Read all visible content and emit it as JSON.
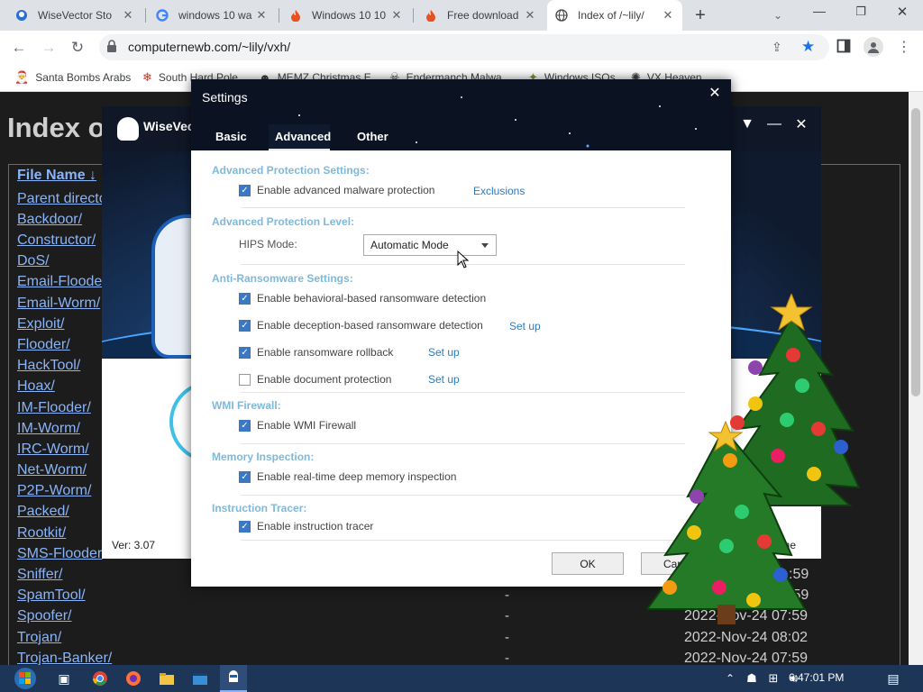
{
  "browser": {
    "tabs": [
      {
        "label": "WiseVector Sto",
        "icon": "wisevector-icon"
      },
      {
        "label": "windows 10 wa",
        "icon": "google-icon"
      },
      {
        "label": "Windows 10 10",
        "icon": "flame-icon"
      },
      {
        "label": "Free download",
        "icon": "flame-icon"
      },
      {
        "label": "Index of /~lily/",
        "icon": "globe-icon"
      }
    ],
    "new_tab": "+",
    "url": "computernewb.com/~lily/vxh/",
    "bookmarks": [
      {
        "label": "Santa Bombs Arabs",
        "icon": "santa-icon"
      },
      {
        "label": "South Hard Pole",
        "icon": "snowflake-icon"
      },
      {
        "label": "MEMZ Christmas E",
        "icon": "memz-icon"
      },
      {
        "label": "Endermanch Malwa",
        "icon": "skull-icon"
      },
      {
        "label": "Windows ISOs",
        "icon": "windows-icon"
      },
      {
        "label": "VX Heaven",
        "icon": "vx-icon"
      }
    ]
  },
  "listing": {
    "title": "Index o",
    "column_header": "File Name  ↓",
    "entries": [
      "Parent directo",
      "Backdoor/",
      "Constructor/",
      "DoS/",
      "Email-Floode",
      "Email-Worm/",
      "Exploit/",
      "Flooder/",
      "HackTool/",
      "Hoax/",
      "IM-Flooder/",
      "IM-Worm/",
      "IRC-Worm/",
      "Net-Worm/",
      "P2P-Worm/",
      "Packed/",
      "Rootkit/",
      "SMS-Flooder",
      "Sniffer/",
      "SpamTool/",
      "Spoofer/",
      "Trojan/",
      "Trojan-Banker/"
    ],
    "rows_right": [
      {
        "size": "-",
        "date": ":59"
      },
      {
        "size": "-",
        "date": ":59"
      },
      {
        "size": "-",
        "date": "2022-Nov-24 07:59"
      },
      {
        "size": "-",
        "date": "2022-Nov-24 08:02"
      },
      {
        "size": "-",
        "date": "2022-Nov-24 07:59"
      }
    ]
  },
  "wisevector": {
    "title": "WiseVec",
    "version": "Ver: 3.07",
    "quarantine": "ntine"
  },
  "settings": {
    "title": "Settings",
    "tabs": [
      "Basic",
      "Advanced",
      "Other"
    ],
    "active_tab": "Advanced",
    "sections": {
      "adv_protection_settings": "Advanced Protection Settings:",
      "adv_protection_level": "Advanced Protection Level:",
      "anti_ransomware": "Anti-Ransomware Settings:",
      "wmi_firewall": "WMI Firewall:",
      "memory_inspection": "Memory Inspection:",
      "instruction_tracer": "Instruction Tracer:"
    },
    "options": {
      "malware_protection": {
        "label": "Enable advanced malware protection",
        "checked": true
      },
      "exclusions_link": "Exclusions",
      "hips_label": "HIPS Mode:",
      "hips_value": "Automatic Mode",
      "behavioral_ransomware": {
        "label": "Enable behavioral-based ransomware detection",
        "checked": true
      },
      "deception_ransomware": {
        "label": "Enable deception-based ransomware detection",
        "checked": true
      },
      "ransomware_rollback": {
        "label": "Enable ransomware rollback",
        "checked": true
      },
      "document_protection": {
        "label": "Enable document protection",
        "checked": false
      },
      "wmi_firewall": {
        "label": "Enable WMI Firewall",
        "checked": true
      },
      "deep_memory": {
        "label": "Enable real-time deep memory inspection",
        "checked": true
      },
      "instruction_tracer": {
        "label": "Enable instruction tracer",
        "checked": true
      },
      "setup_link": "Set up"
    },
    "ok_label": "OK",
    "cancel_label": "Can"
  },
  "taskbar": {
    "time": "6:47:01 PM"
  },
  "colors": {
    "link": "#8ab4f8",
    "checkbox": "#3b78c4",
    "section_heading": "#7fb9d9",
    "dialog_header": "#0b1222",
    "taskbar": "#1d3557"
  }
}
